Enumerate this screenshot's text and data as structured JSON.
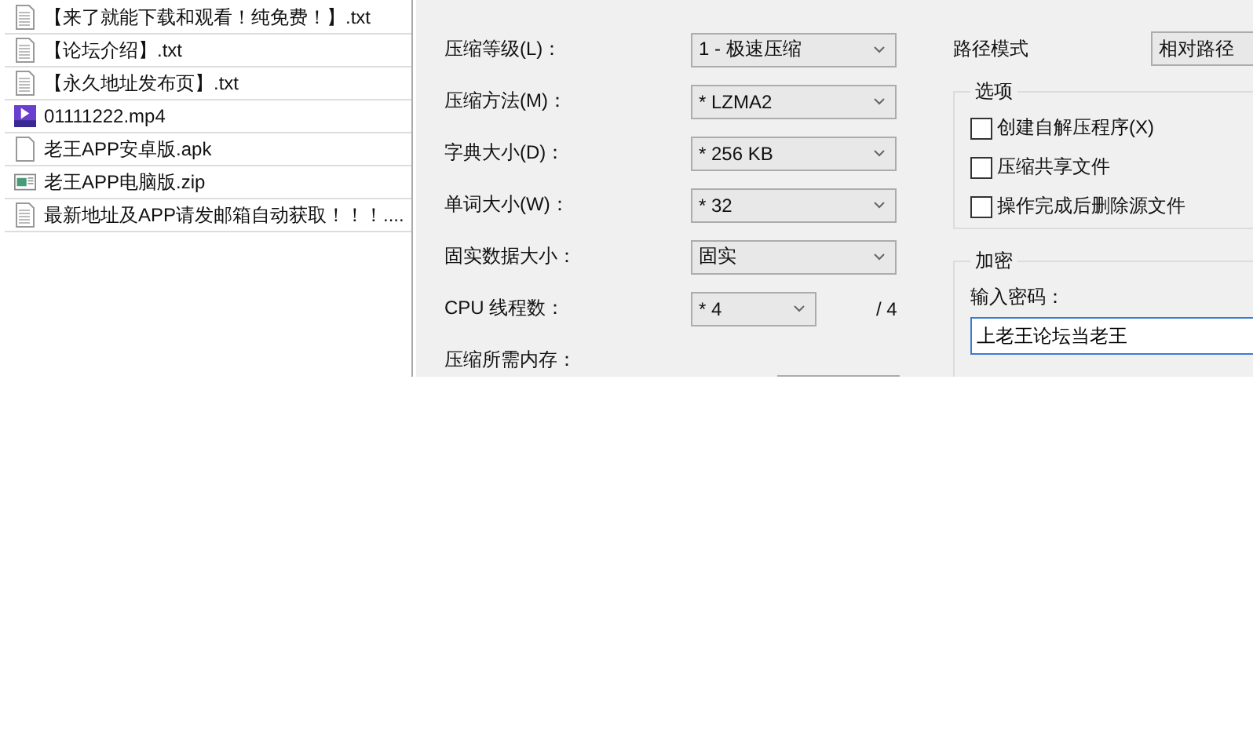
{
  "file_list": [
    {
      "name": "【来了就能下载和观看！纯免费！】.txt",
      "kind": "text"
    },
    {
      "name": "【论坛介绍】.txt",
      "kind": "text"
    },
    {
      "name": "【永久地址发布页】.txt",
      "kind": "text"
    },
    {
      "name": "01111222.mp4",
      "kind": "video"
    },
    {
      "name": "老王APP安卓版.apk",
      "kind": "blank"
    },
    {
      "name": "老王APP电脑版.zip",
      "kind": "archive"
    },
    {
      "name": "最新地址及APP请发邮箱自动获取！！！....",
      "kind": "text"
    }
  ],
  "settings": [
    {
      "label": "压缩等级(L)：",
      "value": "1 - 极速压缩",
      "kind": "select"
    },
    {
      "label": "压缩方法(M)：",
      "value": "* LZMA2",
      "kind": "select"
    },
    {
      "label": "字典大小(D)：",
      "value": "* 256 KB",
      "kind": "select"
    },
    {
      "label": "单词大小(W)：",
      "value": "* 32",
      "kind": "select"
    },
    {
      "label": "固实数据大小：",
      "value": "固实",
      "kind": "select"
    },
    {
      "label": "CPU 线程数：",
      "value": "* 4",
      "kind": "small-select",
      "suffix": "/ 4"
    },
    {
      "label": "压缩所需内存：",
      "kind": "readout"
    }
  ],
  "path_mode": {
    "label": "路径模式",
    "value": "相对路径"
  },
  "options": {
    "title": "选项",
    "checkboxes": [
      {
        "label": "创建自解压程序(X)",
        "checked": false
      },
      {
        "label": "压缩共享文件",
        "checked": false
      },
      {
        "label": "操作完成后删除源文件",
        "checked": false
      }
    ]
  },
  "encryption": {
    "title": "加密",
    "password_label": "输入密码：",
    "password": "上老王论坛当老王"
  }
}
